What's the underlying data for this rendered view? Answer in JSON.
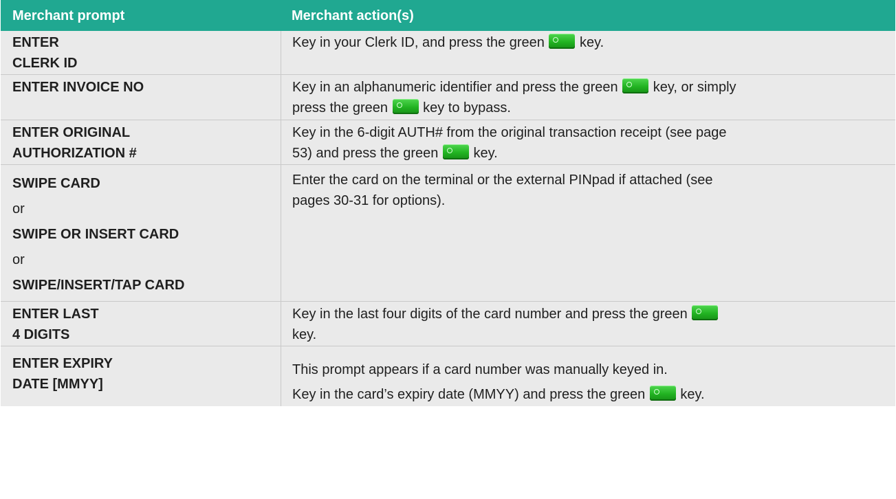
{
  "table": {
    "headers": [
      "Merchant prompt",
      "Merchant action(s)"
    ],
    "rows": [
      {
        "prompt": [
          "ENTER",
          "CLERK ID"
        ],
        "action": [
          "Key in your Clerk ID, and press the green ",
          " key."
        ]
      },
      {
        "prompt": [
          "ENTER INVOICE NO"
        ],
        "action": [
          "Key in an alphanumeric identifier and press the green ",
          " key, or simply",
          "press the green ",
          " key to bypass."
        ]
      },
      {
        "prompt": [
          "ENTER ORIGINAL",
          "AUTHORIZATION #"
        ],
        "action": [
          "Key in the 6-digit AUTH# from the original transaction receipt (see page",
          "53) and press the green ",
          " key."
        ]
      },
      {
        "prompt": [
          "SWIPE CARD",
          "or",
          "SWIPE OR INSERT CARD",
          "or",
          "SWIPE/INSERT/TAP CARD"
        ],
        "action": [
          "Enter the card on the terminal or the external PINpad if attached (see",
          "pages 30-31 for options)."
        ]
      },
      {
        "prompt": [
          "ENTER LAST",
          "4 DIGITS"
        ],
        "action": [
          "Key in the last four digits of the card number and press the green ",
          "key."
        ]
      },
      {
        "prompt": [
          "ENTER EXPIRY",
          "DATE [MMYY]"
        ],
        "action": [
          "This prompt appears if a card number was manually keyed in.",
          "Key in the card’s expiry date (MMYY) and press the green ",
          " key."
        ]
      }
    ]
  },
  "icons": {
    "green_key": "green-key-icon"
  },
  "colors": {
    "header_bg": "#20a891",
    "header_text": "#ffffff",
    "row_bg": "#eaeaea",
    "key_green": "#22b322"
  }
}
